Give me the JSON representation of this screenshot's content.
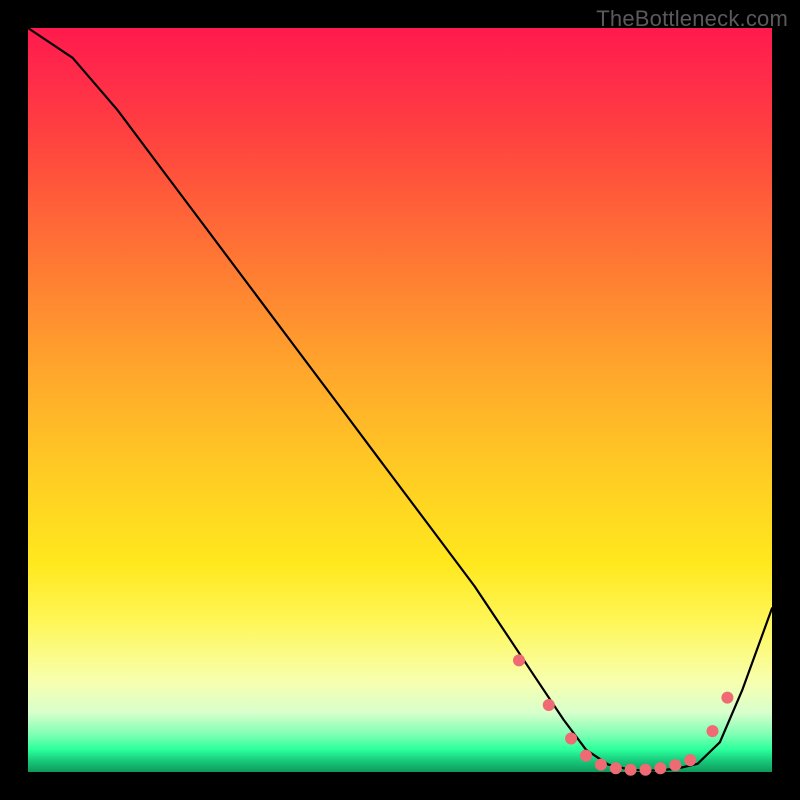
{
  "watermark": "TheBottleneck.com",
  "chart_data": {
    "type": "line",
    "title": "",
    "xlabel": "",
    "ylabel": "",
    "xlim": [
      0,
      100
    ],
    "ylim": [
      0,
      100
    ],
    "grid": false,
    "legend": false,
    "series": [
      {
        "name": "curve",
        "x": [
          0,
          6,
          12,
          18,
          24,
          30,
          36,
          42,
          48,
          54,
          60,
          64,
          68,
          72,
          75,
          78,
          81,
          84,
          87,
          90,
          93,
          96,
          100
        ],
        "y": [
          100,
          96,
          89,
          81,
          73,
          65,
          57,
          49,
          41,
          33,
          25,
          19,
          13,
          7,
          3,
          1,
          0.3,
          0.2,
          0.4,
          1.1,
          4,
          11,
          22
        ]
      }
    ],
    "markers": [
      {
        "x": 66,
        "y": 15
      },
      {
        "x": 70,
        "y": 9
      },
      {
        "x": 73,
        "y": 4.5
      },
      {
        "x": 75,
        "y": 2.2
      },
      {
        "x": 77,
        "y": 1.0
      },
      {
        "x": 79,
        "y": 0.5
      },
      {
        "x": 81,
        "y": 0.3
      },
      {
        "x": 83,
        "y": 0.3
      },
      {
        "x": 85,
        "y": 0.5
      },
      {
        "x": 87,
        "y": 0.9
      },
      {
        "x": 89,
        "y": 1.6
      },
      {
        "x": 92,
        "y": 5.5
      },
      {
        "x": 94,
        "y": 10
      }
    ],
    "gradient_stops": [
      {
        "pos": 0.0,
        "color": "#ff1a4d"
      },
      {
        "pos": 0.32,
        "color": "#ff7a33"
      },
      {
        "pos": 0.62,
        "color": "#ffd122"
      },
      {
        "pos": 0.88,
        "color": "#f7ffb0"
      },
      {
        "pos": 0.97,
        "color": "#2bff9c"
      },
      {
        "pos": 1.0,
        "color": "#0e9a5c"
      }
    ]
  }
}
